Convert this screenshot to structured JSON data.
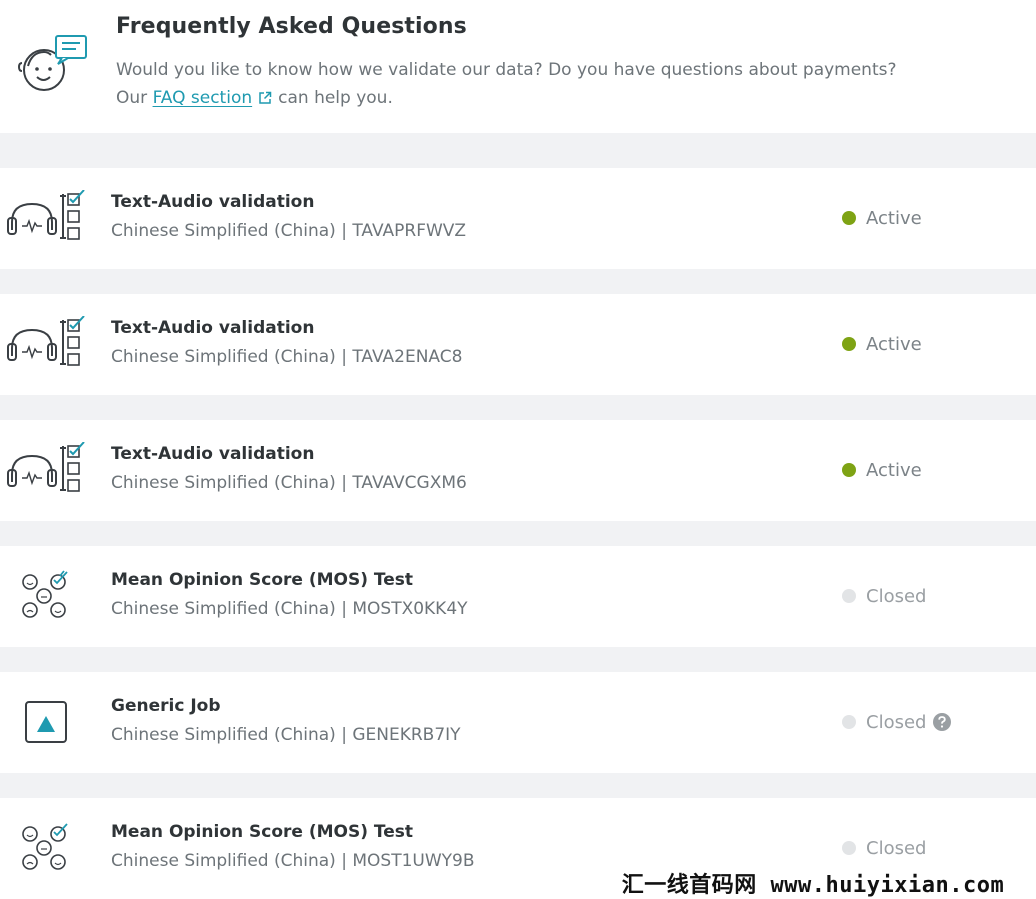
{
  "faq": {
    "title": "Frequently Asked Questions",
    "line1": "Would you like to know how we validate our data? Do you have questions about payments?",
    "line2_prefix": "Our",
    "link_text": "FAQ section",
    "line2_suffix": "can help you.",
    "icon": "baby-face-chat-icon"
  },
  "colors": {
    "active_dot": "#7ea314",
    "closed_dot": "#e2e4e6",
    "link": "#1f9ab0",
    "generic_icon_accent": "#1f9ab0"
  },
  "jobs": [
    {
      "title": "Text-Audio validation",
      "subtitle": "Chinese Simplified (China) | TAVAPRFWVZ",
      "status": "Active",
      "icon": "headphones-checklist-icon"
    },
    {
      "title": "Text-Audio validation",
      "subtitle": "Chinese Simplified (China) | TAVA2ENAC8",
      "status": "Active",
      "icon": "headphones-checklist-icon"
    },
    {
      "title": "Text-Audio validation",
      "subtitle": "Chinese Simplified (China) | TAVAVCGXM6",
      "status": "Active",
      "icon": "headphones-checklist-icon"
    },
    {
      "title": "Mean Opinion Score (MOS) Test",
      "subtitle": "Chinese Simplified (China) | MOSTX0KK4Y",
      "status": "Closed",
      "icon": "mos-faces-icon"
    },
    {
      "title": "Generic Job",
      "subtitle": "Chinese Simplified (China) | GENEKRB7IY",
      "status": "Closed",
      "icon": "generic-triangle-icon",
      "help": "help-icon"
    },
    {
      "title": "Mean Opinion Score (MOS) Test",
      "subtitle": "Chinese Simplified (China) | MOST1UWY9B",
      "status": "Closed",
      "icon": "mos-faces-icon"
    }
  ],
  "watermark": "汇一线首码网 www.huiyixian.com"
}
